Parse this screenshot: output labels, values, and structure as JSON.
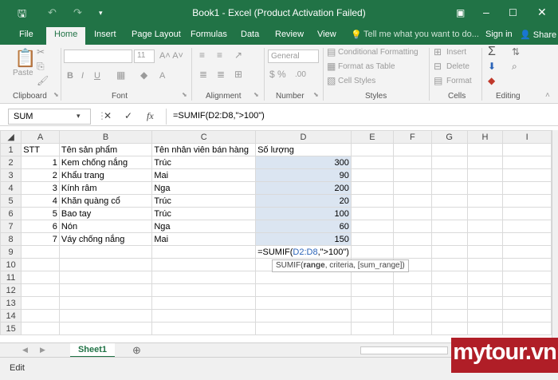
{
  "title": "Book1 - Excel (Product Activation Failed)",
  "tabs": [
    "File",
    "Home",
    "Insert",
    "Page Layout",
    "Formulas",
    "Data",
    "Review",
    "View"
  ],
  "tell_me": "Tell me what you want to do...",
  "sign_in": "Sign in",
  "share": "Share",
  "ribbon": {
    "paste": "Paste",
    "font_size": "11",
    "number_format": "General",
    "conditional": "Conditional Formatting",
    "format_table": "Format as Table",
    "cell_styles": "Cell Styles",
    "insert": "Insert",
    "delete": "Delete",
    "format": "Format",
    "groups": [
      "Clipboard",
      "Font",
      "Alignment",
      "Number",
      "Styles",
      "Cells",
      "Editing"
    ]
  },
  "name_box": "SUM",
  "formula": "=SUMIF(D2:D8,\">100\")",
  "columns": [
    "A",
    "B",
    "C",
    "D",
    "E",
    "F",
    "G",
    "H",
    "I"
  ],
  "rows": [
    [
      "STT",
      "Tên sản phẩm",
      "Tên nhân viên bán hàng",
      "Số lượng"
    ],
    [
      "1",
      "Kem chống nắng",
      "Trúc",
      "300"
    ],
    [
      "2",
      "Khẩu trang",
      "Mai",
      "90"
    ],
    [
      "3",
      "Kính râm",
      "Nga",
      "200"
    ],
    [
      "4",
      "Khăn quàng cổ",
      "Trúc",
      "20"
    ],
    [
      "5",
      "Bao tay",
      "Trúc",
      "100"
    ],
    [
      "6",
      "Nón",
      "Nga",
      "60"
    ],
    [
      "7",
      "Váy chống nắng",
      "Mai",
      "150"
    ]
  ],
  "edit_cell_prefix": "=SUMIF(",
  "edit_cell_ref": "D2:D8",
  "edit_cell_suffix": ",\">100\")",
  "tooltip_fn": "SUMIF(",
  "tooltip_bold": "range",
  "tooltip_rest": ", criteria, [sum_range])",
  "sheet_tab": "Sheet1",
  "status": "Edit",
  "logo": "mytour.vn"
}
